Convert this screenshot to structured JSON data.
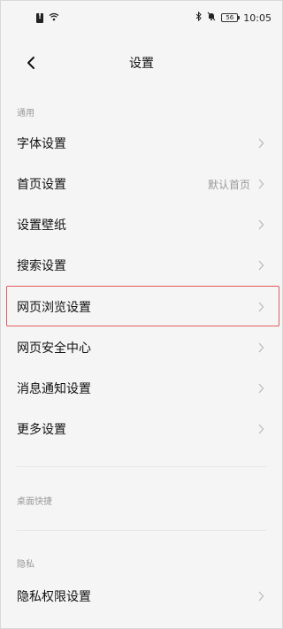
{
  "status": {
    "time": "10:05",
    "battery": "56"
  },
  "header": {
    "title": "设置"
  },
  "sections": {
    "general": "通用",
    "desktop": "桌面快捷",
    "privacy": "隐私"
  },
  "rows": [
    {
      "label": "字体设置",
      "value": ""
    },
    {
      "label": "首页设置",
      "value": "默认首页"
    },
    {
      "label": "设置壁纸",
      "value": ""
    },
    {
      "label": "搜索设置",
      "value": ""
    },
    {
      "label": "网页浏览设置",
      "value": ""
    },
    {
      "label": "网页安全中心",
      "value": ""
    },
    {
      "label": "消息通知设置",
      "value": ""
    },
    {
      "label": "更多设置",
      "value": ""
    }
  ],
  "privacy_rows": [
    {
      "label": "隐私权限设置"
    }
  ],
  "colors": {
    "highlight": "#e35b5b",
    "background": "#f5f5f5",
    "muted_text": "#9a9a9a"
  }
}
